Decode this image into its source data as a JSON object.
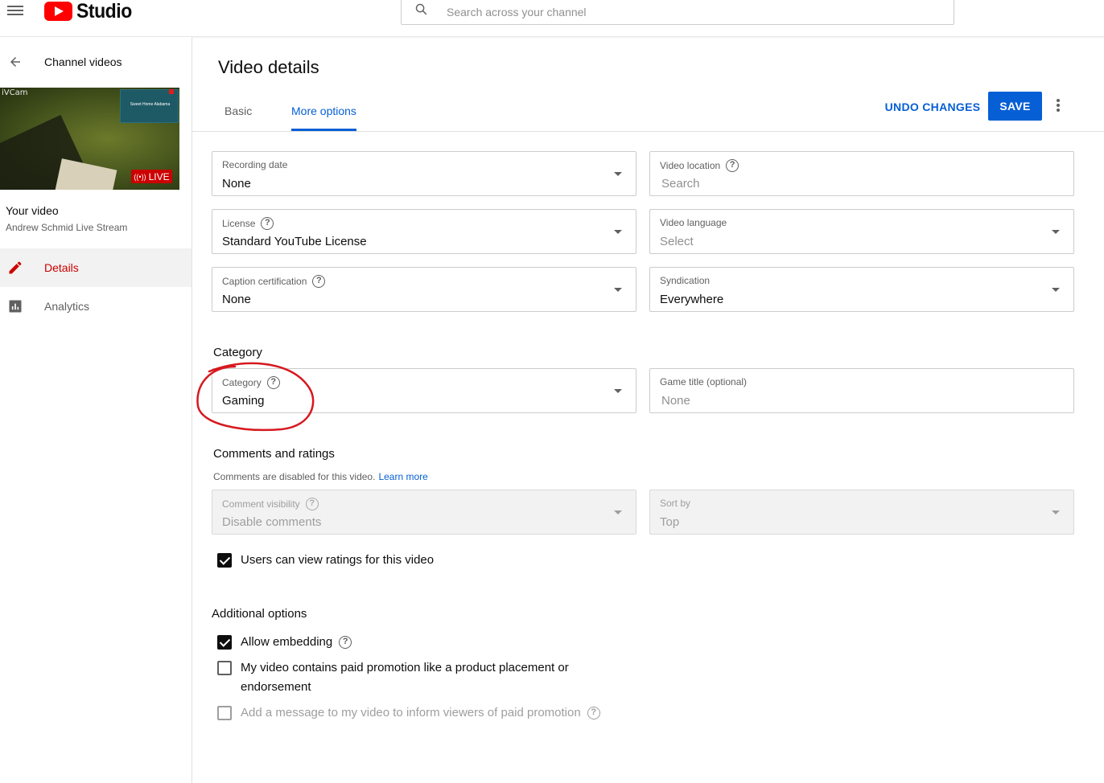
{
  "header": {
    "app_name": "Studio",
    "search_placeholder": "Search across your channel"
  },
  "sidebar": {
    "back_label": "Channel videos",
    "thumbnail": {
      "camera_text": "iVCam",
      "card_text": "Sweet Home Alabama",
      "live_label": "LIVE"
    },
    "your_video_label": "Your video",
    "channel_name": "Andrew Schmid Live Stream",
    "nav": {
      "details": "Details",
      "analytics": "Analytics"
    }
  },
  "main": {
    "title": "Video details",
    "tabs": {
      "basic": "Basic",
      "more": "More options"
    },
    "undo_label": "UNDO CHANGES",
    "save_label": "SAVE",
    "fields": {
      "recording_date": {
        "label": "Recording date",
        "value": "None"
      },
      "video_location": {
        "label": "Video location",
        "value": "Search"
      },
      "license": {
        "label": "License",
        "value": "Standard YouTube License"
      },
      "video_language": {
        "label": "Video language",
        "value": "Select"
      },
      "caption_cert": {
        "label": "Caption certification",
        "value": "None"
      },
      "syndication": {
        "label": "Syndication",
        "value": "Everywhere"
      },
      "category": {
        "label": "Category",
        "value": "Gaming"
      },
      "game_title": {
        "label": "Game title (optional)",
        "value": "None"
      },
      "comment_visibility": {
        "label": "Comment visibility",
        "value": "Disable comments"
      },
      "sort_by": {
        "label": "Sort by",
        "value": "Top"
      }
    },
    "sections": {
      "category": "Category",
      "comments": "Comments and ratings",
      "comments_sub": "Comments are disabled for this video.",
      "learn_more": "Learn more",
      "additional": "Additional options"
    },
    "checkboxes": {
      "view_ratings": {
        "label": "Users can view ratings for this video",
        "checked": true
      },
      "allow_embedding": {
        "label": "Allow embedding",
        "checked": true
      },
      "paid_promotion_line1": "My video contains paid promotion like a product placement or",
      "paid_promotion_line2": "endorsement",
      "paid_promotion_checked": false,
      "add_message": {
        "label": "Add a message to my video to inform viewers of paid promotion",
        "checked": false
      }
    }
  },
  "colors": {
    "brand_red": "#ff0000",
    "link_blue": "#065fd4",
    "active_red": "#cc0000",
    "annotation_red": "#d6191f"
  }
}
